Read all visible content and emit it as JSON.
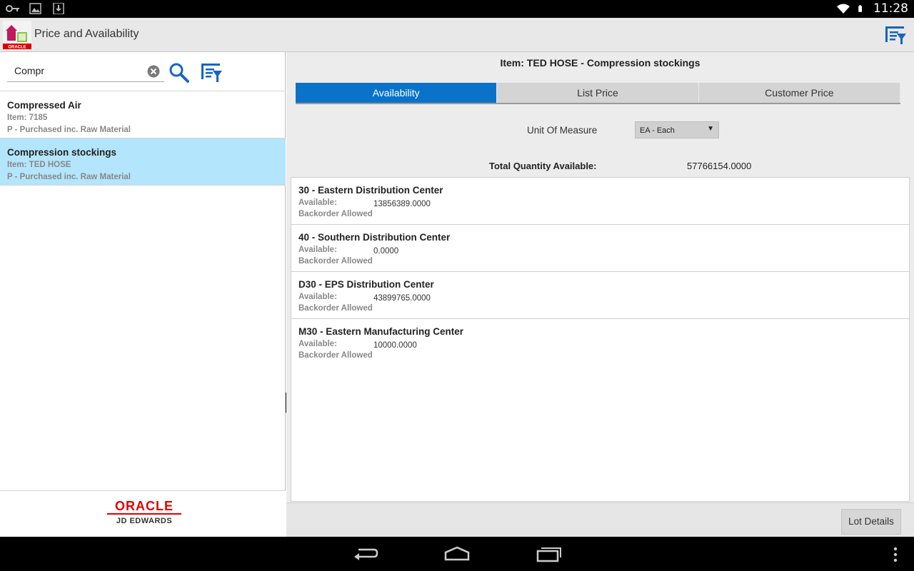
{
  "status": {
    "clock": "11:28",
    "icons": [
      "key-icon",
      "image-icon",
      "download-icon",
      "wifi-icon",
      "battery-icon"
    ]
  },
  "actionbar": {
    "title": "Price and Availability",
    "app_icon": "jde-app-icon",
    "filter_icon": "filter-list-icon"
  },
  "search": {
    "value": "Compr",
    "placeholder": ""
  },
  "items": [
    {
      "title": "Compressed Air",
      "item": "Item: 7185",
      "type": "P - Purchased inc. Raw Material"
    },
    {
      "title": "Compression stockings",
      "item": "Item: TED HOSE",
      "type": "P - Purchased inc. Raw Material"
    }
  ],
  "footer": {
    "oracle": "ORACLE",
    "jde": "JD EDWARDS"
  },
  "detail": {
    "header": "Item: TED HOSE - Compression stockings",
    "tabs": [
      "Availability",
      "List Price",
      "Customer Price"
    ],
    "uom_label": "Unit Of Measure",
    "uom_value": "EA - Each",
    "total_label": "Total Quantity Available:",
    "total_value": "57766154.0000",
    "available_label": "Available:",
    "backorder_label": "Backorder Allowed",
    "branches": [
      {
        "name": "30 - Eastern Distribution Center",
        "available": "13856389.0000"
      },
      {
        "name": "40 - Southern Distribution Center",
        "available": "0.0000"
      },
      {
        "name": "D30 - EPS Distribution Center",
        "available": "43899765.0000"
      },
      {
        "name": "M30 - Eastern Manufacturing Center",
        "available": "10000.0000"
      }
    ],
    "lot_button": "Lot Details"
  },
  "colors": {
    "accent": "#0a73c9",
    "selected_row": "#b3e5fc",
    "oracle_red": "#e00000"
  }
}
